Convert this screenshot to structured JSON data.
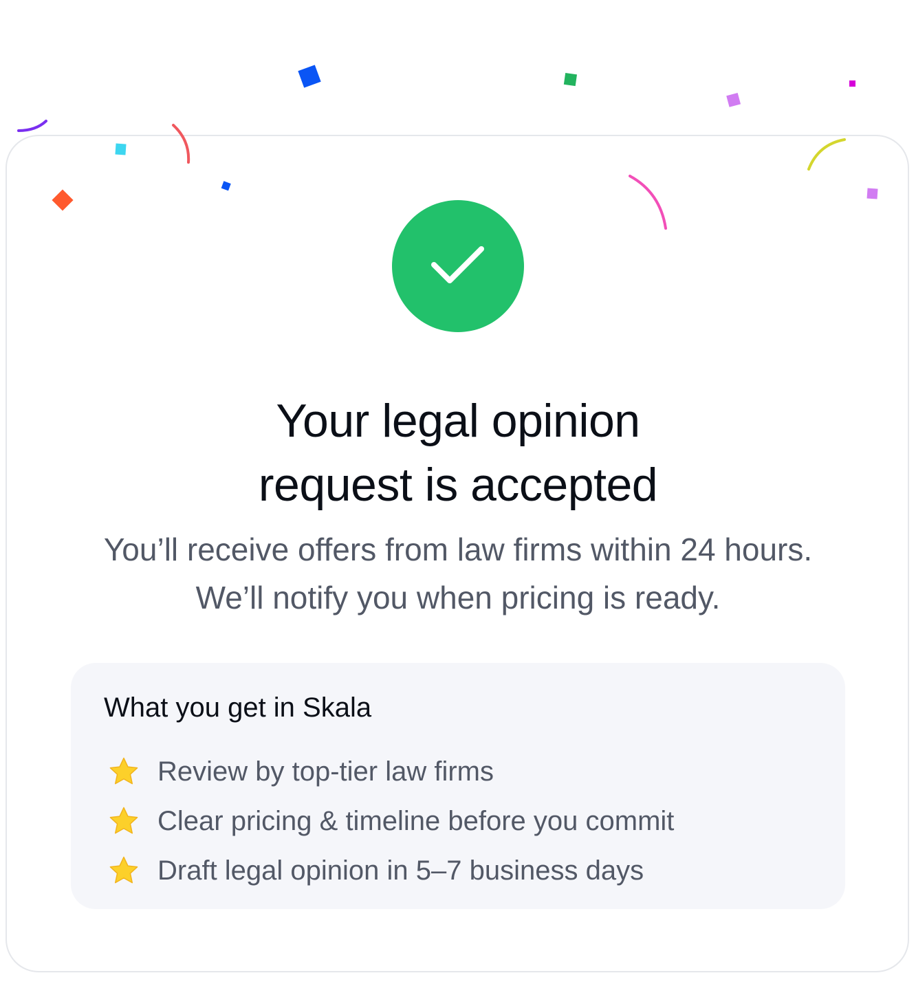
{
  "dialog": {
    "icon": "check-circle-icon",
    "title_line1": "Your legal opinion",
    "title_line2": "request is accepted",
    "subtitle_line1": "You’ll receive offers from law firms within 24 hours.",
    "subtitle_line2": "We’ll notify you when pricing is ready."
  },
  "benefits": {
    "heading": "What you get in Skala",
    "items": [
      {
        "icon": "star-icon",
        "label": "Review by top-tier law firms"
      },
      {
        "icon": "star-icon",
        "label": "Clear pricing & timeline before you commit"
      },
      {
        "icon": "star-icon",
        "label": "Draft legal opinion in 5–7 business days"
      }
    ]
  },
  "colors": {
    "success": "#22c16b",
    "heading_text": "#0b0f17",
    "body_text": "#525866",
    "panel_bg": "#f5f6fa",
    "card_border": "#e5e7eb",
    "star": "#fcd02a",
    "confetti": [
      "#0a55f5",
      "#22b35e",
      "#d17cf2",
      "#d600d9",
      "#7a2ff0",
      "#f0585e",
      "#3dd6f0",
      "#ff5a2e",
      "#0a55f5",
      "#d4d62e",
      "#f24fb8",
      "#d17cf2"
    ]
  }
}
